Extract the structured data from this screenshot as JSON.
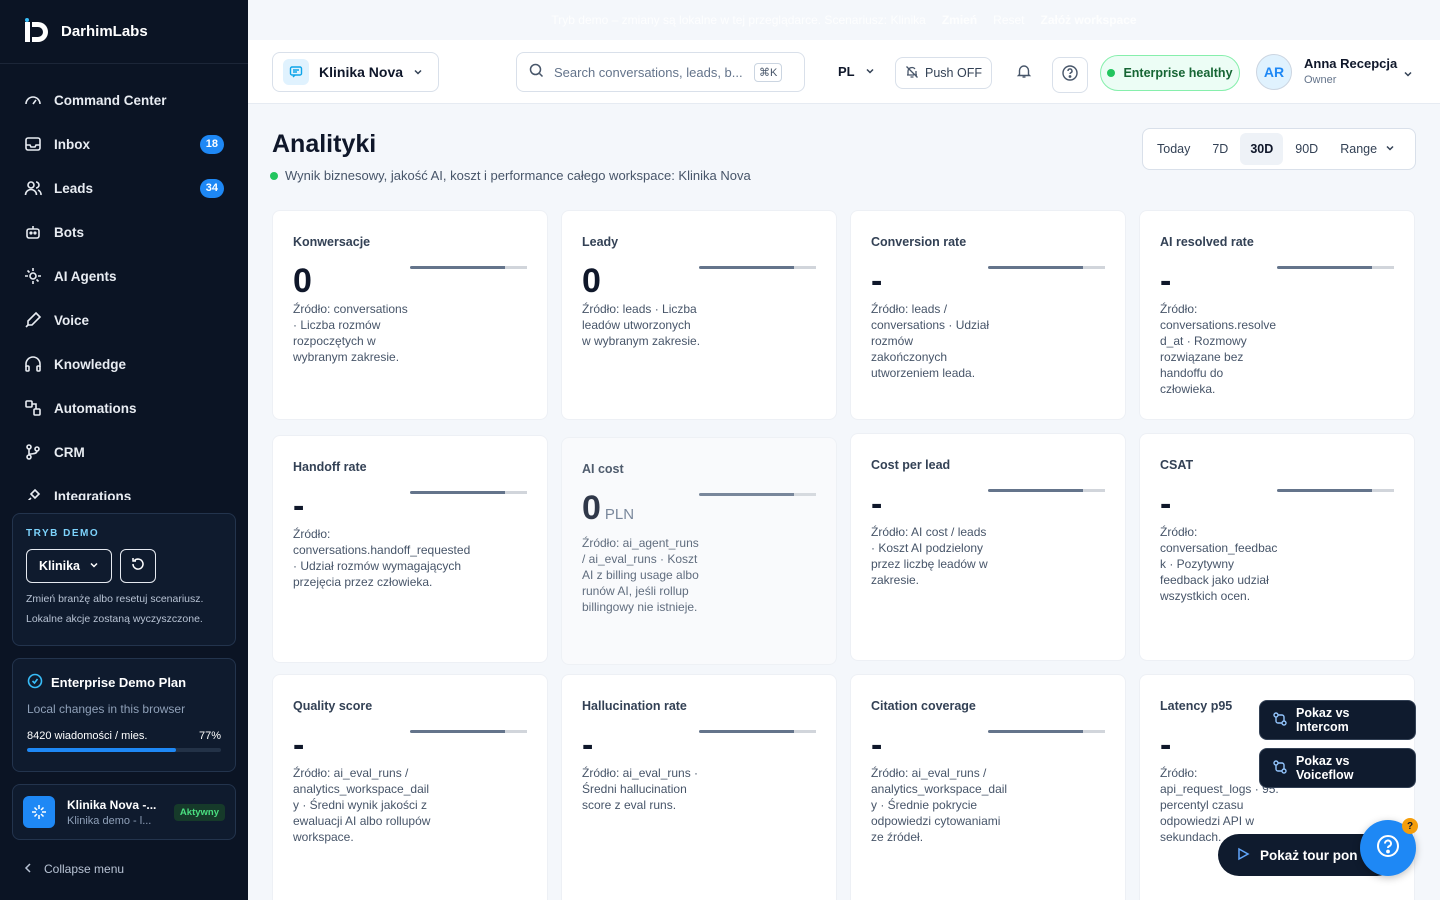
{
  "brand": {
    "name": "DarhimLabs"
  },
  "sidebar": {
    "items": [
      {
        "label": "Command Center",
        "icon": "gauge-icon"
      },
      {
        "label": "Inbox",
        "icon": "inbox-icon",
        "badge": "18"
      },
      {
        "label": "Leads",
        "icon": "users-icon",
        "badge": "34"
      },
      {
        "label": "Bots",
        "icon": "bot-icon"
      },
      {
        "label": "AI Agents",
        "icon": "agents-icon"
      },
      {
        "label": "Voice",
        "icon": "voice-icon"
      },
      {
        "label": "Knowledge",
        "icon": "headphones-icon"
      },
      {
        "label": "Automations",
        "icon": "automations-icon"
      },
      {
        "label": "CRM",
        "icon": "crm-icon"
      },
      {
        "label": "Integrations",
        "icon": "integrations-icon"
      }
    ],
    "demo": {
      "title": "TRYB DEMO",
      "select_value": "Klinika",
      "text": "Zmień branżę albo resetuj scenariusz. Lokalne akcje zostaną wyczyszczone."
    },
    "plan": {
      "title": "Enterprise Demo Plan",
      "subtitle": "Local changes in this browser",
      "usage_label": "8420 wiadomości / mies.",
      "usage_percent": "77%",
      "usage_fraction": 0.77
    },
    "workspace": {
      "name": "Klinika Nova -...",
      "subtitle": "Klinika demo - l...",
      "status": "Aktywny"
    },
    "collapse_label": "Collapse menu"
  },
  "banner": {
    "text": "Tryb demo – zmiany są lokalne w tej przeglądarce. Scenariusz: Klinika",
    "change_label": "Zmień",
    "reset_label": "Reset",
    "create_label": "Załóż workspace"
  },
  "header": {
    "workspace": "Klinika Nova",
    "search_placeholder": "Search conversations, leads, b...",
    "search_shortcut": "⌘K",
    "language": "PL",
    "push_label": "Push OFF",
    "health_label": "Enterprise healthy",
    "user": {
      "initials": "AR",
      "name": "Anna Recepcja",
      "role": "Owner"
    }
  },
  "page": {
    "title": "Analityki",
    "subtitle": "Wynik biznesowy, jakość AI, koszt i performance całego workspace: Klinika Nova",
    "ranges": [
      "Today",
      "7D",
      "30D",
      "90D",
      "Range"
    ],
    "active_range": "30D"
  },
  "cards": [
    {
      "title": "Konwersacje",
      "value": "0",
      "desc": "Źródło: conversations · Liczba rozmów rozpoczętych w wybranym zakresie."
    },
    {
      "title": "Leady",
      "value": "0",
      "desc": "Źródło: leads · Liczba leadów utworzonych w wybranym zakresie."
    },
    {
      "title": "Conversion rate",
      "value": "-",
      "desc": "Źródło: leads / conversations · Udział rozmów zakończonych utworzeniem leada."
    },
    {
      "title": "AI resolved rate",
      "value": "-",
      "desc": "Źródło: conversations.resolved_at · Rozmowy rozwiązane bez handoffu do człowieka."
    },
    {
      "title": "Handoff rate",
      "value": "-",
      "desc": "Źródło: conversations.handoff_requested · Udział rozmów wymagających przejęcia przez człowieka."
    },
    {
      "title": "AI cost",
      "value": "0",
      "unit": "PLN",
      "desc": "Źródło: ai_agent_runs / ai_eval_runs · Koszt AI z billing usage albo runów AI, jeśli rollup billingowy nie istnieje."
    },
    {
      "title": "Cost per lead",
      "value": "-",
      "desc": "Źródło: AI cost / leads · Koszt AI podzielony przez liczbę leadów w zakresie."
    },
    {
      "title": "CSAT",
      "value": "-",
      "desc": "Źródło: conversation_feedback · Pozytywny feedback jako udział wszystkich ocen."
    },
    {
      "title": "Quality score",
      "value": "-",
      "desc": "Źródło: ai_eval_runs / analytics_workspace_daily · Średni wynik jakości z ewaluacji AI albo rollupów workspace."
    },
    {
      "title": "Hallucination rate",
      "value": "-",
      "desc": "Źródło: ai_eval_runs · Średni hallucination score z eval runs."
    },
    {
      "title": "Citation coverage",
      "value": "-",
      "desc": "Źródło: ai_eval_runs / analytics_workspace_daily · Średnie pokrycie odpowiedzi cytowaniami ze źródeł."
    },
    {
      "title": "Latency p95",
      "value": "-",
      "desc": "Źródło: api_request_logs · 95. percentyl czasu odpowiedzi API w sekundach."
    }
  ],
  "floating": {
    "intercom_label": "Pokaz vs Intercom",
    "voiceflow_label": "Pokaz vs Voiceflow",
    "tour_label": "Pokaż tour pon",
    "help_badge": "?"
  },
  "colors": {
    "accent": "#1e88f5",
    "sidebar_bg": "#0b1424",
    "healthy": "#22c55e"
  }
}
